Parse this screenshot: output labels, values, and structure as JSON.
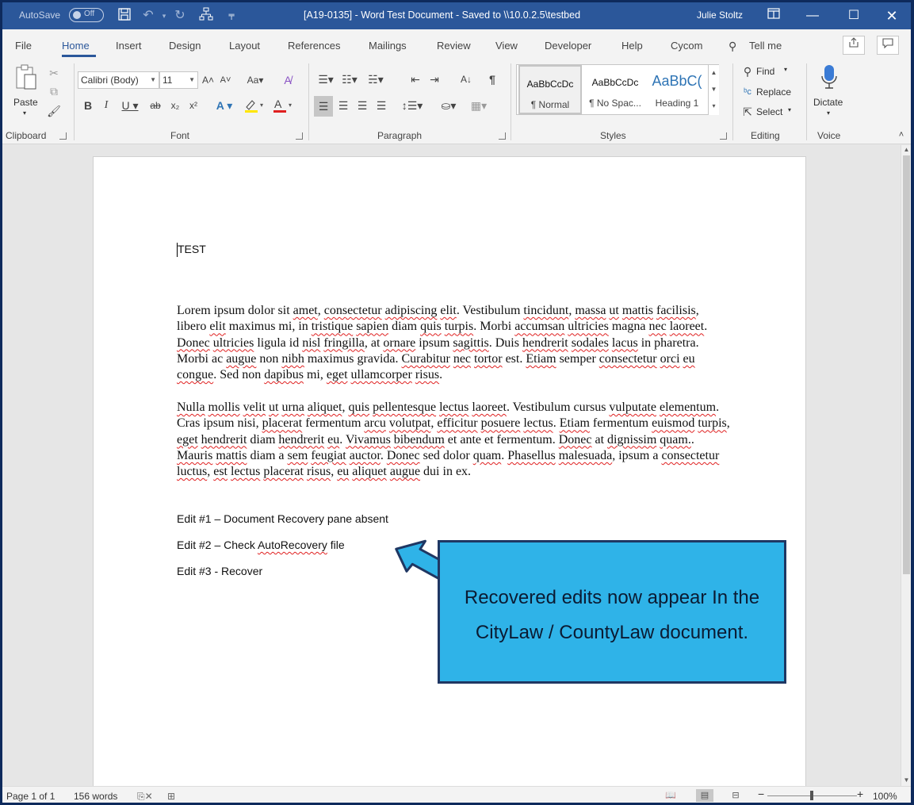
{
  "titlebar": {
    "autosave_label": "AutoSave",
    "autosave_state": "Off",
    "document_title": "[A19-0135] - Word Test Document  -  Saved to \\\\10.0.2.5\\testbed",
    "user_name": "Julie Stoltz",
    "accent_color": "#2b579a"
  },
  "menu": {
    "tabs": [
      "File",
      "Home",
      "Insert",
      "Design",
      "Layout",
      "References",
      "Mailings",
      "Review",
      "View",
      "Developer",
      "Help",
      "Cycom"
    ],
    "active_tab": "Home",
    "tell_me": "Tell me"
  },
  "ribbon": {
    "clipboard": {
      "label": "Clipboard",
      "paste": "Paste"
    },
    "font": {
      "label": "Font",
      "font_name": "Calibri (Body)",
      "font_size": "11"
    },
    "paragraph": {
      "label": "Paragraph"
    },
    "styles": {
      "label": "Styles",
      "items": [
        {
          "sample": "AaBbCcDc",
          "name": "¶ Normal"
        },
        {
          "sample": "AaBbCcDc",
          "name": "¶ No Spac..."
        },
        {
          "sample": "AaBbC(",
          "name": "Heading 1"
        }
      ]
    },
    "editing": {
      "label": "Editing",
      "find": "Find",
      "replace": "Replace",
      "select": "Select"
    },
    "voice": {
      "label": "Voice",
      "dictate": "Dictate"
    }
  },
  "document": {
    "title": "TEST",
    "paragraph1": [
      [
        "Lorem ipsum dolor sit ",
        false
      ],
      [
        "amet",
        true
      ],
      [
        ", ",
        false
      ],
      [
        "consectetur",
        true
      ],
      [
        " ",
        false
      ],
      [
        "adipiscing",
        true
      ],
      [
        " ",
        false
      ],
      [
        "elit",
        true
      ],
      [
        ". Vestibulum ",
        false
      ],
      [
        "tincidunt",
        true
      ],
      [
        ", ",
        false
      ],
      [
        "massa",
        true
      ],
      [
        " ",
        false
      ],
      [
        "ut",
        true
      ],
      [
        " ",
        false
      ],
      [
        "mattis",
        true
      ],
      [
        " ",
        false
      ],
      [
        "facilisis",
        true
      ],
      [
        ", libero ",
        false
      ],
      [
        "elit",
        true
      ],
      [
        " maximus mi, in ",
        false
      ],
      [
        "tristique",
        true
      ],
      [
        " ",
        false
      ],
      [
        "sapien",
        true
      ],
      [
        " diam ",
        false
      ],
      [
        "quis",
        true
      ],
      [
        " ",
        false
      ],
      [
        "turpis",
        true
      ],
      [
        ". Morbi ",
        false
      ],
      [
        "accumsan",
        true
      ],
      [
        " ",
        false
      ],
      [
        "ultricies",
        true
      ],
      [
        " magna ",
        false
      ],
      [
        "nec",
        true
      ],
      [
        " ",
        false
      ],
      [
        "laoreet",
        true
      ],
      [
        ". ",
        false
      ],
      [
        "Donec",
        true
      ],
      [
        " ",
        false
      ],
      [
        "ultricies",
        true
      ],
      [
        " ligula id ",
        false
      ],
      [
        "nisl",
        true
      ],
      [
        " ",
        false
      ],
      [
        "fringilla",
        true
      ],
      [
        ", at ",
        false
      ],
      [
        "ornare",
        true
      ],
      [
        " ipsum ",
        false
      ],
      [
        "sagittis",
        true
      ],
      [
        ". Duis ",
        false
      ],
      [
        "hendrerit",
        true
      ],
      [
        " ",
        false
      ],
      [
        "sodales",
        true
      ],
      [
        " ",
        false
      ],
      [
        "lacus",
        true
      ],
      [
        " in pharetra. Morbi ac ",
        false
      ],
      [
        "augue",
        true
      ],
      [
        " non ",
        false
      ],
      [
        "nibh",
        true
      ],
      [
        " maximus gravida. ",
        false
      ],
      [
        "Curabitur",
        true
      ],
      [
        " ",
        false
      ],
      [
        "nec",
        true
      ],
      [
        " ",
        false
      ],
      [
        "tortor",
        true
      ],
      [
        " est. ",
        false
      ],
      [
        "Etiam",
        true
      ],
      [
        " semper ",
        false
      ],
      [
        "consectetur",
        true
      ],
      [
        " ",
        false
      ],
      [
        "orci",
        true
      ],
      [
        " ",
        false
      ],
      [
        "eu",
        true
      ],
      [
        " ",
        false
      ],
      [
        "congue",
        true
      ],
      [
        ". Sed non ",
        false
      ],
      [
        "dapibus",
        true
      ],
      [
        " mi, ",
        false
      ],
      [
        "eget",
        true
      ],
      [
        " ",
        false
      ],
      [
        "ullamcorper",
        true
      ],
      [
        " ",
        false
      ],
      [
        "risus",
        true
      ],
      [
        ".",
        false
      ]
    ],
    "paragraph2": [
      [
        "Nulla",
        true
      ],
      [
        " ",
        false
      ],
      [
        "mollis",
        true
      ],
      [
        " ",
        false
      ],
      [
        "velit",
        true
      ],
      [
        " ",
        false
      ],
      [
        "ut",
        true
      ],
      [
        " ",
        false
      ],
      [
        "urna",
        true
      ],
      [
        " ",
        false
      ],
      [
        "aliquet",
        true
      ],
      [
        ", ",
        false
      ],
      [
        "quis",
        true
      ],
      [
        " ",
        false
      ],
      [
        "pellentesque",
        true
      ],
      [
        " ",
        false
      ],
      [
        "lectus",
        true
      ],
      [
        " ",
        false
      ],
      [
        "laoreet",
        true
      ],
      [
        ". Vestibulum cursus ",
        false
      ],
      [
        "vulputate",
        true
      ],
      [
        " ",
        false
      ],
      [
        "elementum",
        true
      ],
      [
        ". Cras ipsum nisi, ",
        false
      ],
      [
        "placerat",
        true
      ],
      [
        " fermentum ",
        false
      ],
      [
        "arcu",
        true
      ],
      [
        " ",
        false
      ],
      [
        "volutpat",
        true
      ],
      [
        ", ",
        false
      ],
      [
        "efficitur",
        true
      ],
      [
        " ",
        false
      ],
      [
        "posuere",
        true
      ],
      [
        " ",
        false
      ],
      [
        "lectus",
        true
      ],
      [
        ". ",
        false
      ],
      [
        "Etiam",
        true
      ],
      [
        " fermentum ",
        false
      ],
      [
        "euismod",
        true
      ],
      [
        " ",
        false
      ],
      [
        "turpis",
        true
      ],
      [
        ", ",
        false
      ],
      [
        "eget",
        true
      ],
      [
        " ",
        false
      ],
      [
        "hendrerit",
        true
      ],
      [
        " diam ",
        false
      ],
      [
        "hendrerit",
        true
      ],
      [
        " ",
        false
      ],
      [
        "eu",
        true
      ],
      [
        ". ",
        false
      ],
      [
        "Vivamus",
        true
      ],
      [
        " ",
        false
      ],
      [
        "bibendum",
        true
      ],
      [
        " et ante et fermentum. ",
        false
      ],
      [
        "Donec",
        true
      ],
      [
        " at ",
        false
      ],
      [
        "dignissim",
        true
      ],
      [
        " ",
        false
      ],
      [
        "quam.",
        true
      ],
      [
        ". ",
        false
      ],
      [
        "Mauris",
        true
      ],
      [
        " ",
        false
      ],
      [
        "mattis",
        true
      ],
      [
        " diam a ",
        false
      ],
      [
        "sem",
        true
      ],
      [
        " ",
        false
      ],
      [
        "feugiat",
        true
      ],
      [
        " ",
        false
      ],
      [
        "auctor",
        true
      ],
      [
        ". ",
        false
      ],
      [
        "Donec",
        true
      ],
      [
        " sed dolor ",
        false
      ],
      [
        "quam",
        true
      ],
      [
        ". ",
        false
      ],
      [
        "Phasellus",
        true
      ],
      [
        " ",
        false
      ],
      [
        "malesuada",
        true
      ],
      [
        ", ipsum a ",
        false
      ],
      [
        "consectetur",
        true
      ],
      [
        " ",
        false
      ],
      [
        "luctus",
        true
      ],
      [
        ", ",
        false
      ],
      [
        "est",
        true
      ],
      [
        " ",
        false
      ],
      [
        "lectus",
        true
      ],
      [
        " ",
        false
      ],
      [
        "placerat",
        true
      ],
      [
        " ",
        false
      ],
      [
        "risus",
        true
      ],
      [
        ", ",
        false
      ],
      [
        "eu",
        true
      ],
      [
        " ",
        false
      ],
      [
        "aliquet",
        true
      ],
      [
        " ",
        false
      ],
      [
        "augue",
        true
      ],
      [
        " dui in ex.",
        false
      ]
    ],
    "edit1": "Edit #1 – Document Recovery pane absent",
    "edit2_prefix": "Edit #2 – Check ",
    "edit2_link": "AutoRecovery",
    "edit2_suffix": " file",
    "edit3": "Edit #3 - Recover"
  },
  "callout": {
    "line1": "Recovered edits now appear In the",
    "line2": "CityLaw / CountyLaw document.",
    "fill_color": "#2fb3e8",
    "border_color": "#1f3763"
  },
  "statusbar": {
    "page": "Page 1 of 1",
    "words": "156 words",
    "zoom": "100%"
  }
}
